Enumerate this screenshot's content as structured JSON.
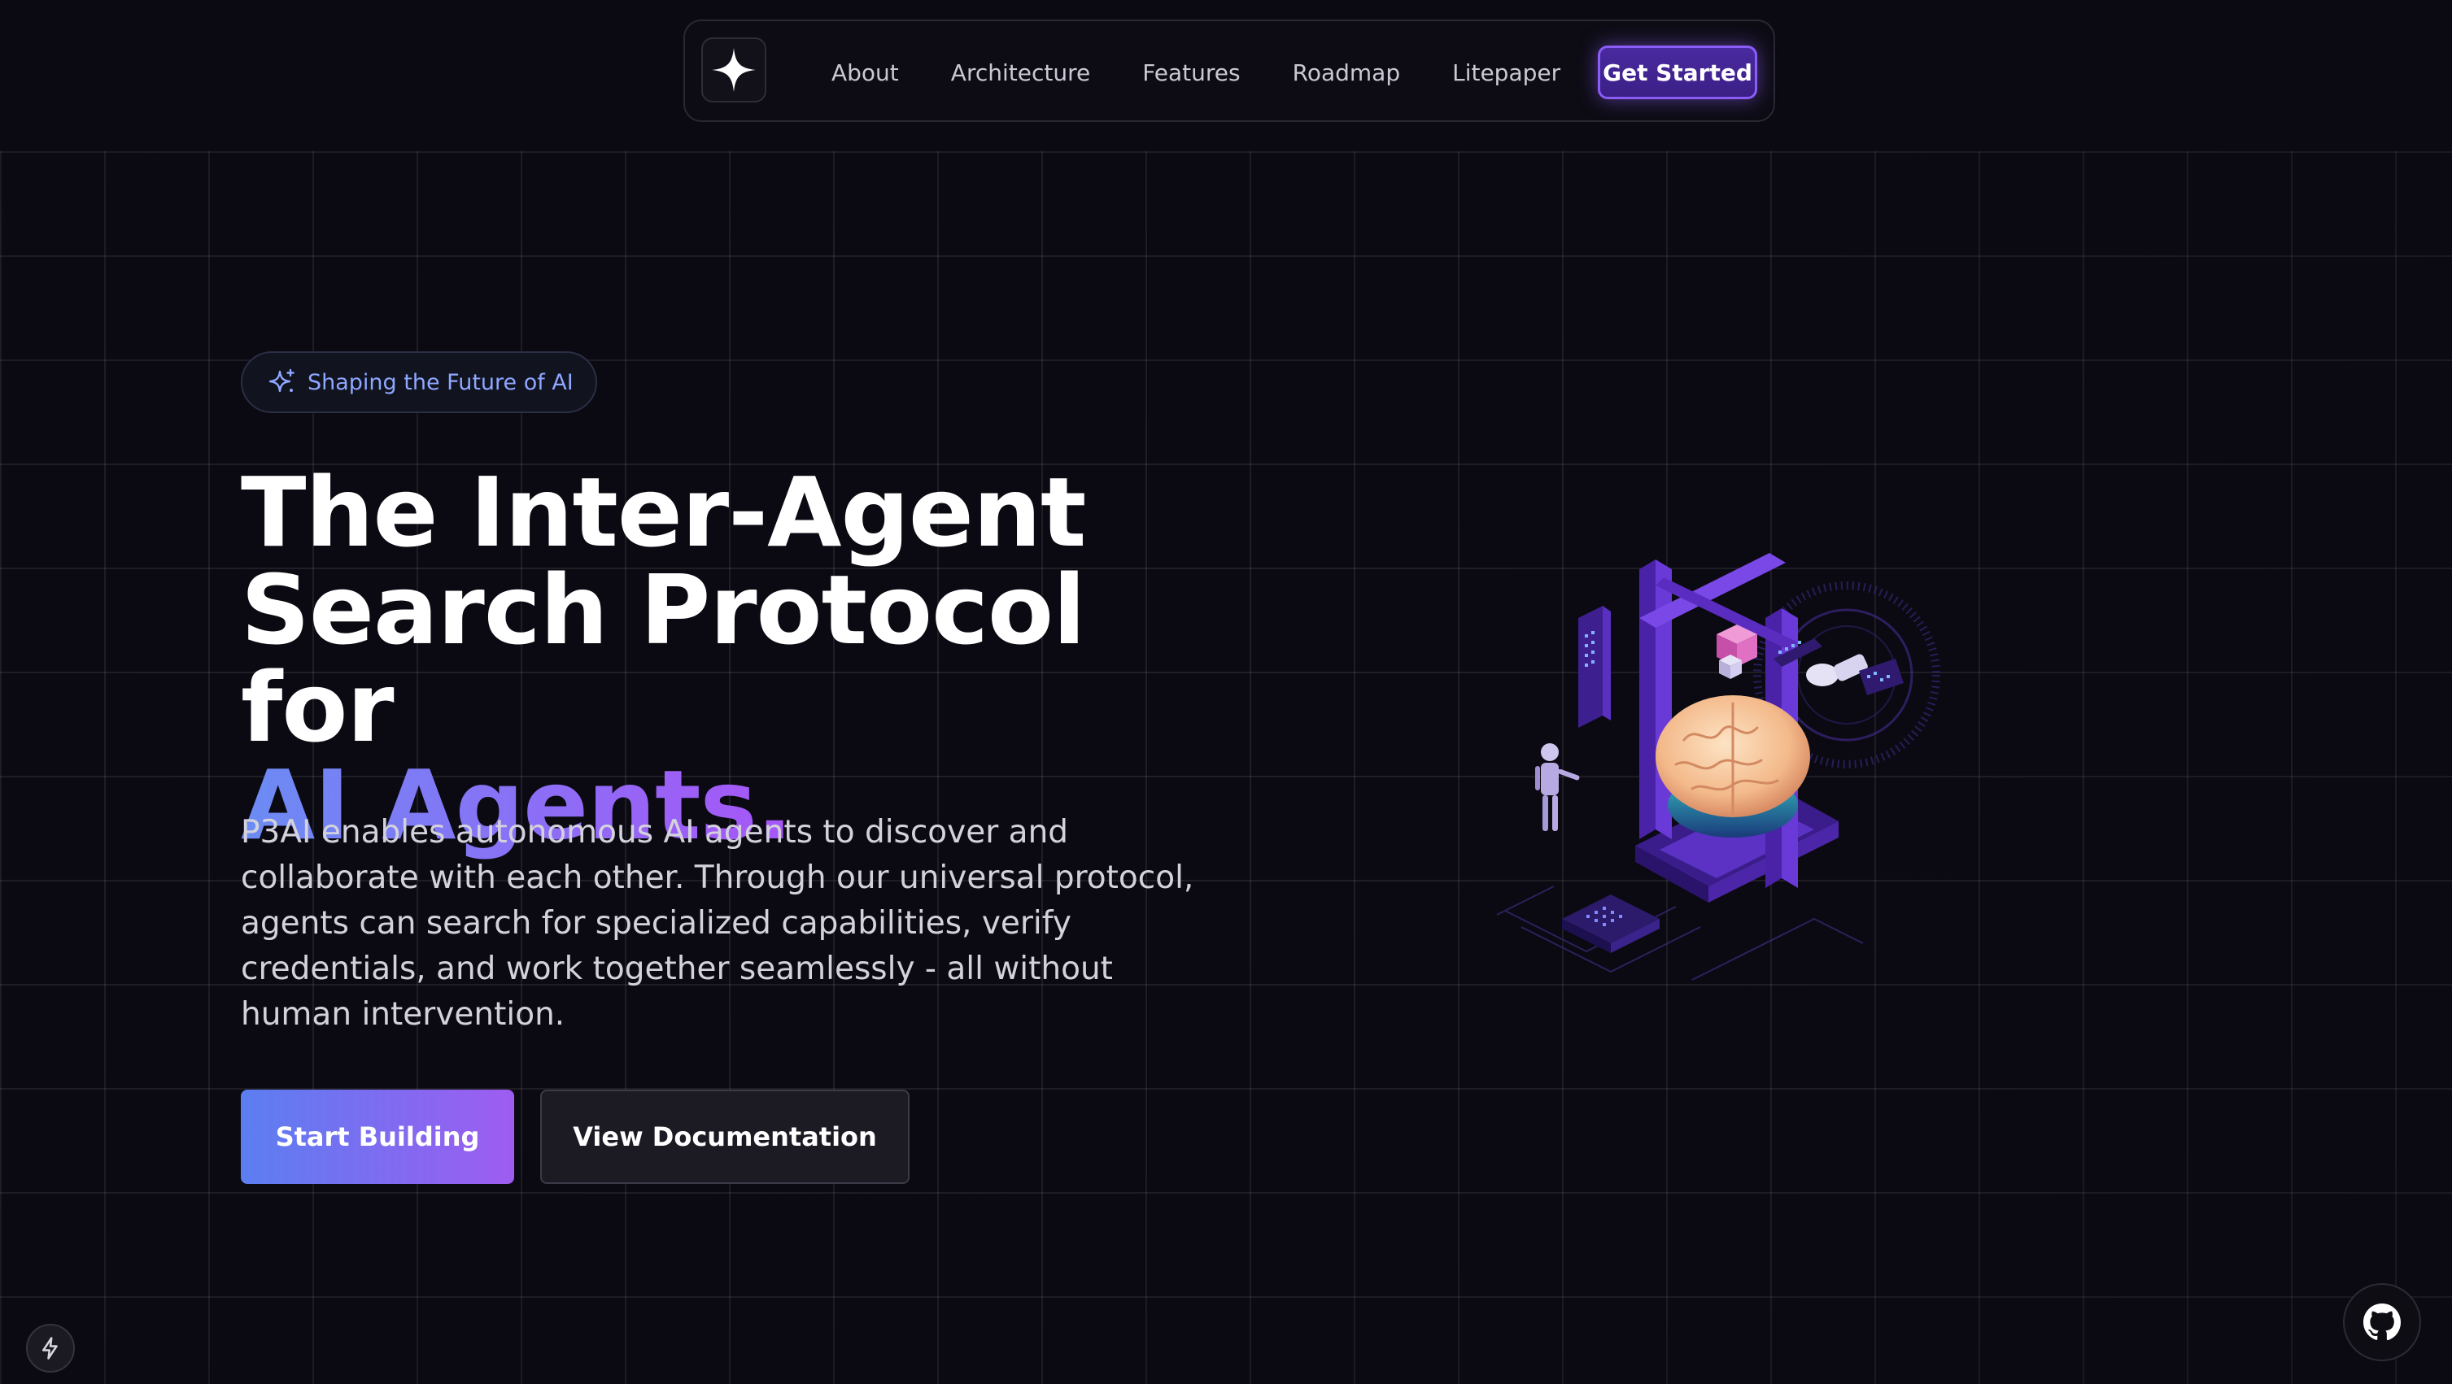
{
  "nav": {
    "logo_icon": "sparkle-star-icon",
    "links": [
      "About",
      "Architecture",
      "Features",
      "Roadmap",
      "Litepaper"
    ],
    "cta_label": "Get Started"
  },
  "hero": {
    "badge_icon": "sparkles-icon",
    "badge_text": "Shaping the Future of AI",
    "headline_line1": "The Inter-Agent",
    "headline_line2": "Search Protocol for",
    "headline_highlight": "AI Agents.",
    "description": "P3AI enables autonomous AI agents to discover and collaborate with each other. Through our universal protocol, agents can search for specialized capabilities, verify credentials, and work together seamlessly - all without human intervention.",
    "primary_button": "Start Building",
    "secondary_button": "View Documentation",
    "illustration": "isometric-ai-brain-illustration"
  },
  "corner": {
    "left_icon": "lightning-icon",
    "right_icon": "github-icon"
  },
  "colors": {
    "background": "#0b0a12",
    "accent_blue": "#6b8cf4",
    "accent_purple": "#a855f7",
    "cta_border": "#8b5cf6"
  }
}
